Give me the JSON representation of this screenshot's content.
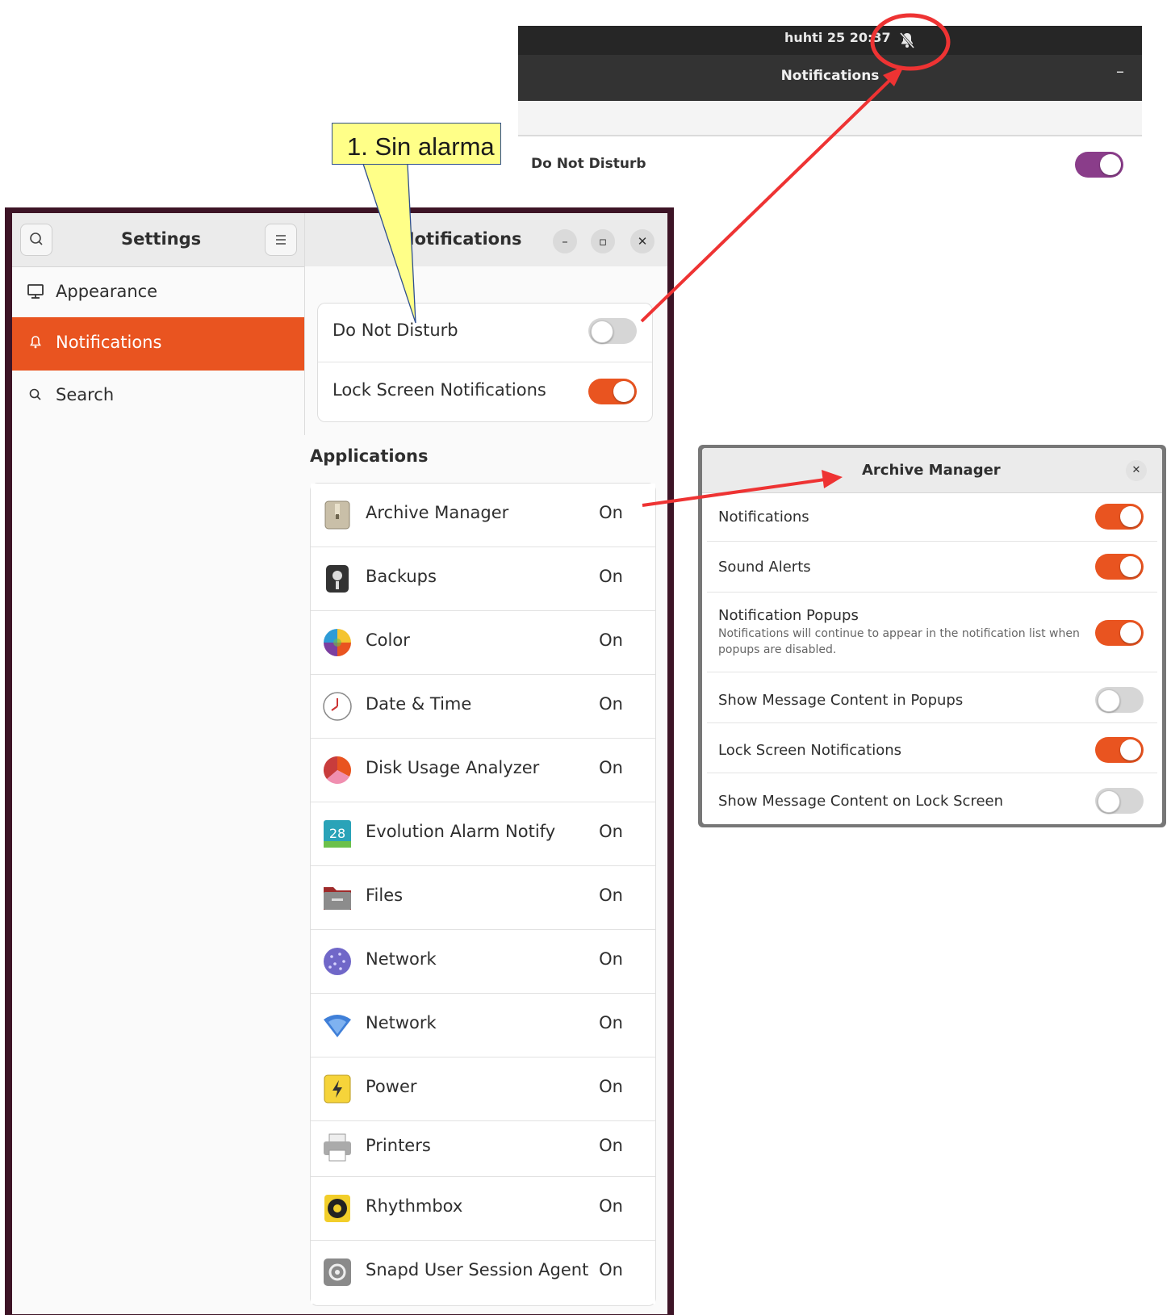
{
  "top_panel": {
    "clock": "huhti 25 20:37",
    "dnd_menu_title": "Notifications",
    "dnd_label": "Do Not Disturb",
    "dnd_on": true
  },
  "callout": {
    "text": "1. Sin alarma"
  },
  "settings": {
    "sidebar_title": "Settings",
    "sidebar_items": [
      {
        "label": "Appearance",
        "icon": "display-icon",
        "active": false
      },
      {
        "label": "Notifications",
        "icon": "bell-icon",
        "active": true
      },
      {
        "label": "Search",
        "icon": "search-icon",
        "active": false
      }
    ],
    "panel_title": "Notifications",
    "toggles": [
      {
        "label": "Do Not Disturb",
        "on": false
      },
      {
        "label": "Lock Screen Notifications",
        "on": true
      }
    ],
    "applications_heading": "Applications",
    "apps": [
      {
        "name": "Archive Manager",
        "status": "On",
        "icon": "archive-icon"
      },
      {
        "name": "Backups",
        "status": "On",
        "icon": "backups-icon"
      },
      {
        "name": "Color",
        "status": "On",
        "icon": "color-wheel-icon"
      },
      {
        "name": "Date & Time",
        "status": "On",
        "icon": "clock-icon"
      },
      {
        "name": "Disk Usage Analyzer",
        "status": "On",
        "icon": "disk-usage-icon"
      },
      {
        "name": "Evolution Alarm Notify",
        "status": "On",
        "icon": "calendar-icon",
        "icon_text": "28"
      },
      {
        "name": "Files",
        "status": "On",
        "icon": "folder-icon"
      },
      {
        "name": "Network",
        "status": "On",
        "icon": "network-globe-icon"
      },
      {
        "name": "Network",
        "status": "On",
        "icon": "wifi-icon"
      },
      {
        "name": "Power",
        "status": "On",
        "icon": "power-icon"
      },
      {
        "name": "Printers",
        "status": "On",
        "icon": "printer-icon"
      },
      {
        "name": "Rhythmbox",
        "status": "On",
        "icon": "rhythmbox-icon"
      },
      {
        "name": "Snapd User Session Agent",
        "status": "On",
        "icon": "snapd-icon"
      }
    ]
  },
  "archive_dialog": {
    "title": "Archive Manager",
    "rows": [
      {
        "label": "Notifications",
        "on": true
      },
      {
        "label": "Sound Alerts",
        "on": true
      },
      {
        "label": "Notification Popups",
        "sub": "Notifications will continue to appear in the notification list when popups are disabled.",
        "on": true
      },
      {
        "label": "Show Message Content in Popups",
        "on": false
      },
      {
        "label": "Lock Screen Notifications",
        "on": true
      },
      {
        "label": "Show Message Content on Lock Screen",
        "on": false
      }
    ]
  },
  "colors": {
    "accent": "#e95420",
    "dnd_purple": "#8a3d8a",
    "annotation_red": "#ee3333",
    "callout_yellow": "#ffff88"
  }
}
